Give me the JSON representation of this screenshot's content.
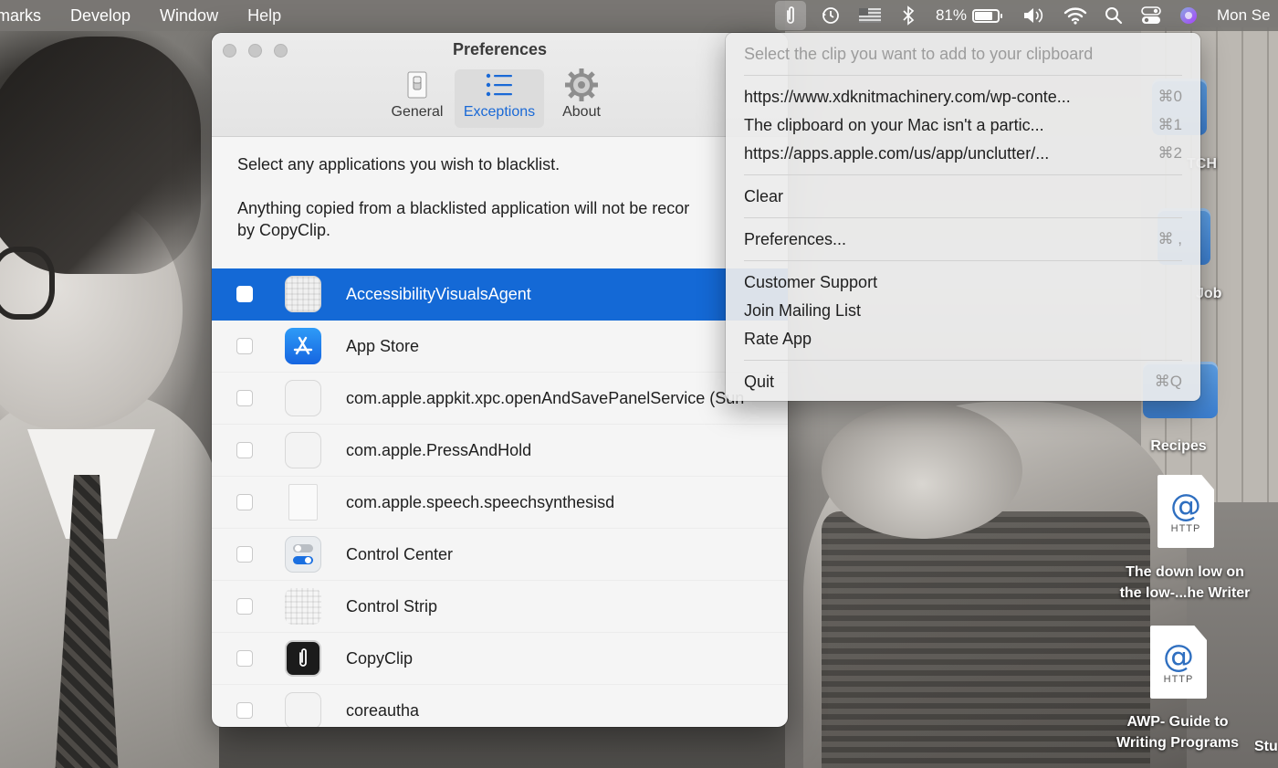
{
  "menubar": {
    "items": [
      "marks",
      "Develop",
      "Window",
      "Help"
    ],
    "battery_percent": "81%",
    "battery_level": 0.81,
    "clock": "Mon Se",
    "icons": [
      "copyclip-paperclip-icon",
      "time-machine-icon",
      "flag-icon",
      "bluetooth-icon",
      "battery-icon",
      "volume-icon",
      "wifi-icon",
      "spotlight-search-icon",
      "control-center-icon",
      "siri-icon"
    ]
  },
  "desktop": {
    "labels": {
      "tch": "TCH",
      "job": "Job",
      "recipes": "Recipes",
      "doc1_line1": "The down low on",
      "doc1_line2": "the low-...he Writer",
      "doc2_line1": "AWP- Guide to",
      "doc2_line2": "Writing Programs",
      "stu": "Stu"
    },
    "http_label": "HTTP",
    "at_glyph": "@"
  },
  "prefs": {
    "title": "Preferences",
    "tabs": [
      {
        "label": "General",
        "icon": "switch-icon"
      },
      {
        "label": "Exceptions",
        "icon": "list-icon"
      },
      {
        "label": "About",
        "icon": "gear-icon"
      }
    ],
    "selected_tab": "Exceptions",
    "intro_line1": "Select any applications you wish to blacklist.",
    "intro_line2": "Anything copied from a blacklisted application will not be recor",
    "intro_line3": "by CopyClip.",
    "apps": [
      {
        "name": "AccessibilityVisualsAgent",
        "icon": "generic-app-icon",
        "selected": true
      },
      {
        "name": "App Store",
        "icon": "app-store-icon"
      },
      {
        "name": "com.apple.appkit.xpc.openAndSavePanelService (Sun",
        "icon": "shield-app-icon"
      },
      {
        "name": "com.apple.PressAndHold",
        "icon": "shield-app-icon"
      },
      {
        "name": "com.apple.speech.speechsynthesisd",
        "icon": "document-icon"
      },
      {
        "name": "Control Center",
        "icon": "control-center-icon"
      },
      {
        "name": "Control Strip",
        "icon": "generic-app-icon"
      },
      {
        "name": "CopyClip",
        "icon": "copyclip-icon"
      },
      {
        "name": "coreautha",
        "icon": "shield-app-icon"
      }
    ]
  },
  "dropdown": {
    "header": "Select the clip you want to add to your clipboard",
    "clips": [
      {
        "text": "https://www.xdknitmachinery.com/wp-conte...",
        "shortcut": "⌘0"
      },
      {
        "text": "The clipboard on your Mac isn't a partic...",
        "shortcut": "⌘1"
      },
      {
        "text": "https://apps.apple.com/us/app/unclutter/...",
        "shortcut": "⌘2"
      }
    ],
    "clear": "Clear",
    "preferences": {
      "text": "Preferences...",
      "shortcut": "⌘ ,"
    },
    "support": "Customer Support",
    "mailing": "Join Mailing List",
    "rate": "Rate App",
    "quit": {
      "text": "Quit",
      "shortcut": "⌘Q"
    }
  },
  "colors": {
    "accent": "#1469d6",
    "menubar": "#787673",
    "window_bg": "#f5f5f5"
  }
}
